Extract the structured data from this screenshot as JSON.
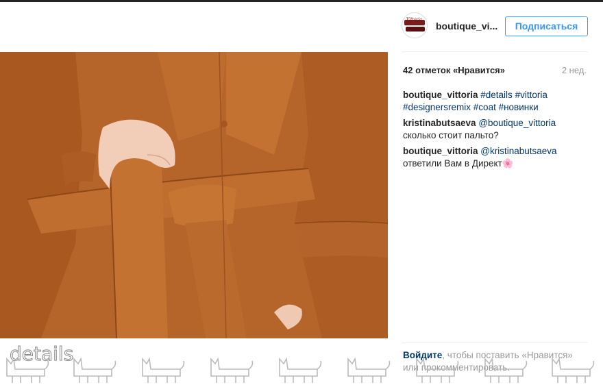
{
  "post": {
    "username": "boutique_vi...",
    "follow_label": "Подписаться",
    "likes_text": "42 отметок «Нравится»",
    "time_text": "2 нед."
  },
  "comments": [
    {
      "author": "boutique_vittoria",
      "text_before": "",
      "tags": [
        "#details",
        "#vittoria",
        "#designersremix",
        "#coat",
        "#новинки"
      ],
      "text_after": ""
    },
    {
      "author": "kristinabutsaeva",
      "mention": "@boutique_vittoria",
      "text": "сколько стоит пальто?"
    },
    {
      "author": "boutique_vittoria",
      "mention": "@kristinabutsaeva",
      "text": "ответили Вам в Директ🌸"
    }
  ],
  "login_prompt": {
    "link": "Войдите",
    "rest": ", чтобы поставить «Нравится» или прокомментировать."
  },
  "watermark": {
    "text": "details"
  },
  "colors": {
    "accent": "#3897f0",
    "link": "#003569",
    "muted": "#999999",
    "coat": "#b8652a"
  },
  "icons": {
    "avatar": "boutique-vittoria-logo",
    "watermark": "cat-doodle-icon"
  }
}
